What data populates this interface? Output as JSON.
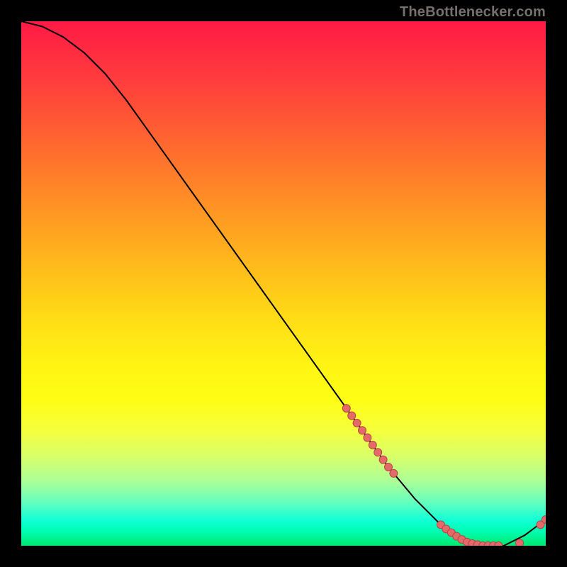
{
  "attribution": "TheBottlenecker.com",
  "colors": {
    "curve": "#000000",
    "point_fill": "#e46a6a",
    "point_stroke": "#b74545",
    "background": "#000000"
  },
  "chart_data": {
    "type": "line",
    "title": "",
    "xlabel": "",
    "ylabel": "",
    "xlim": [
      0,
      100
    ],
    "ylim": [
      0,
      100
    ],
    "grid": false,
    "legend": false,
    "series": [
      {
        "name": "bottleneck-curve",
        "x": [
          0,
          4,
          8,
          12,
          16,
          20,
          25,
          30,
          35,
          40,
          45,
          50,
          55,
          60,
          65,
          70,
          75,
          80,
          84,
          88,
          92,
          96,
          100
        ],
        "y": [
          100,
          99,
          97,
          94,
          90,
          85,
          78,
          71,
          64,
          57,
          50,
          43,
          36,
          29,
          22,
          15,
          9,
          4,
          1,
          0,
          0,
          2,
          5
        ]
      }
    ],
    "markers": {
      "name": "highlight-points",
      "x": [
        62,
        63,
        64,
        65,
        66,
        67,
        68,
        69,
        70,
        71,
        80,
        81,
        82,
        83,
        84,
        85,
        86,
        87,
        88,
        89,
        90,
        91,
        95,
        99,
        100
      ],
      "y": [
        26.2,
        24.8,
        23.4,
        22.0,
        20.6,
        19.2,
        17.8,
        16.4,
        15.0,
        13.8,
        4.0,
        3.2,
        2.5,
        1.8,
        1.2,
        0.7,
        0.4,
        0.2,
        0.0,
        0.0,
        0.0,
        0.0,
        0.5,
        4.0,
        5.0
      ]
    }
  }
}
